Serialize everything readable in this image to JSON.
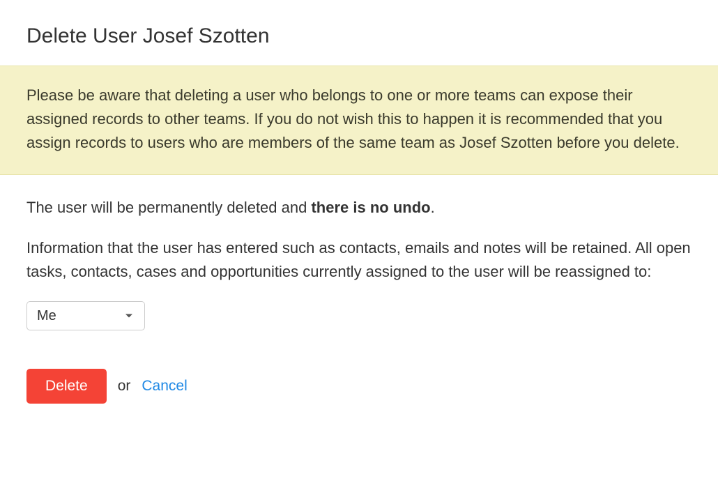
{
  "heading": "Delete User Josef Szotten",
  "warning": "Please be aware that deleting a user who belongs to one or more teams can expose their assigned records to other teams. If you do not wish this to happen it is recommended that you assign records to users who are members of the same team as Josef Szotten before you delete.",
  "permanent_prefix": "The user will be permanently deleted and ",
  "permanent_strong": "there is no undo",
  "permanent_suffix": ".",
  "info_retained": "Information that the user has entered such as contacts, emails and notes will be retained. All open tasks, contacts, cases and opportunities currently assigned to the user will be reassigned to:",
  "reassign": {
    "selected": "Me"
  },
  "actions": {
    "delete": "Delete",
    "or": "or",
    "cancel": "Cancel"
  }
}
